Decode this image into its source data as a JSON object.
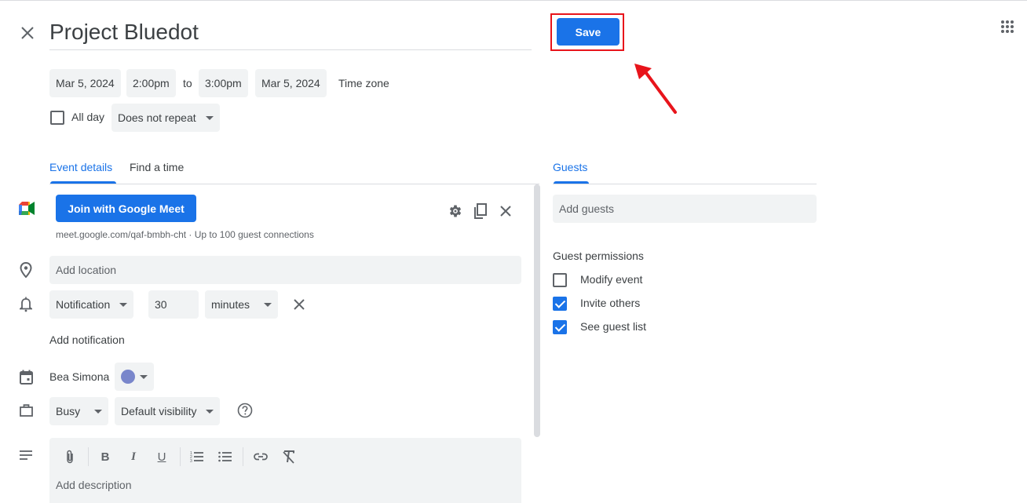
{
  "header": {
    "title": "Project Bluedot",
    "save_label": "Save",
    "close_icon": "close-icon",
    "apps_icon": "apps-grid-icon"
  },
  "datetime": {
    "start_date": "Mar 5, 2024",
    "start_time": "2:00pm",
    "to_label": "to",
    "end_time": "3:00pm",
    "end_date": "Mar 5, 2024",
    "time_zone_label": "Time zone",
    "all_day_label": "All day",
    "all_day_checked": false,
    "repeat_value": "Does not repeat"
  },
  "tabs": {
    "left": [
      {
        "label": "Event details",
        "active": true
      },
      {
        "label": "Find a time",
        "active": false
      }
    ],
    "right": [
      {
        "label": "Guests",
        "active": true
      }
    ]
  },
  "details": {
    "meet_button_label": "Join with Google Meet",
    "meet_info": "meet.google.com/qaf-bmbh-cht · Up to 100 guest connections",
    "location_placeholder": "Add location",
    "notification_type": "Notification",
    "notification_value": "30",
    "notification_unit": "minutes",
    "add_notification_label": "Add notification",
    "calendar_owner": "Bea Simona",
    "calendar_color": "#7986cb",
    "availability": "Busy",
    "visibility": "Default visibility",
    "description_placeholder": "Add description"
  },
  "toolbar": {
    "items": [
      "attach-icon",
      "bold-icon",
      "italic-icon",
      "underline-icon",
      "numbered-list-icon",
      "bulleted-list-icon",
      "link-icon",
      "clear-formatting-icon"
    ]
  },
  "guests": {
    "add_guests_placeholder": "Add guests",
    "permissions_title": "Guest permissions",
    "permissions": [
      {
        "label": "Modify event",
        "checked": false
      },
      {
        "label": "Invite others",
        "checked": true
      },
      {
        "label": "See guest list",
        "checked": true
      }
    ]
  },
  "colors": {
    "accent": "#1a73e8",
    "annotation": "#e8141b"
  }
}
